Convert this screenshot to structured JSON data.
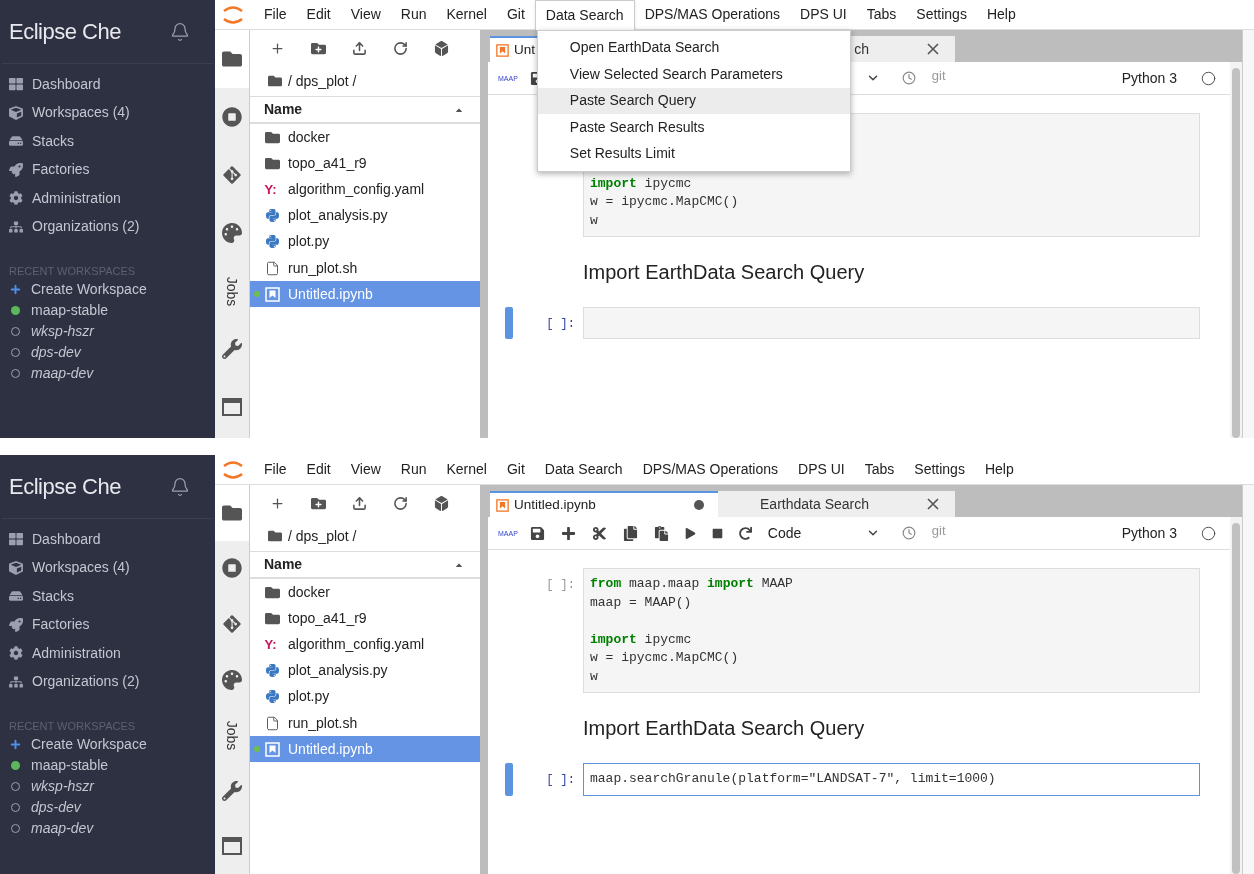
{
  "screens": [
    {
      "che": {
        "brand": "Eclipse Che",
        "nav": [
          {
            "label": "Dashboard"
          },
          {
            "label": "Workspaces (4)"
          },
          {
            "label": "Stacks"
          },
          {
            "label": "Factories"
          },
          {
            "label": "Administration"
          },
          {
            "label": "Organizations (2)"
          }
        ],
        "recent_heading": "RECENT WORKSPACES",
        "recent": [
          {
            "kind": "create",
            "label": "Create Workspace"
          },
          {
            "kind": "workspace",
            "label": "maap-stable",
            "running": true
          },
          {
            "kind": "workspace",
            "label": "wksp-hszr",
            "running": false
          },
          {
            "kind": "workspace",
            "label": "dps-dev",
            "running": false
          },
          {
            "kind": "workspace",
            "label": "maap-dev",
            "running": false
          }
        ]
      },
      "menu": [
        {
          "label": "File",
          "selected": false
        },
        {
          "label": "Edit",
          "selected": false
        },
        {
          "label": "View",
          "selected": false
        },
        {
          "label": "Run",
          "selected": false
        },
        {
          "label": "Kernel",
          "selected": false
        },
        {
          "label": "Git",
          "selected": false
        },
        {
          "label": "Data Search",
          "selected": true,
          "items": [
            {
              "label": "Open EarthData Search",
              "selected": false
            },
            {
              "label": "View Selected Search Parameters",
              "selected": false
            },
            {
              "label": "Paste Search Query",
              "selected": true
            },
            {
              "label": "Paste Search Results",
              "selected": false
            },
            {
              "label": "Set Results Limit",
              "selected": false
            }
          ]
        },
        {
          "label": "DPS/MAS Operations",
          "selected": false
        },
        {
          "label": "DPS UI",
          "selected": false
        },
        {
          "label": "Tabs",
          "selected": false
        },
        {
          "label": "Settings",
          "selected": false
        },
        {
          "label": "Help",
          "selected": false
        }
      ],
      "side_tabs": [
        {
          "kind": "folder",
          "selected": true
        },
        {
          "kind": "running",
          "selected": false
        },
        {
          "kind": "git",
          "selected": false
        },
        {
          "kind": "palette",
          "selected": false
        },
        {
          "kind": "text",
          "label": "Jobs",
          "selected": false
        },
        {
          "kind": "wrench",
          "selected": false
        },
        {
          "kind": "window",
          "selected": false
        }
      ],
      "files": {
        "path": "/ dps_plot /",
        "column": "Name",
        "items": [
          {
            "kind": "folder",
            "name": "docker",
            "selected": false,
            "running": false
          },
          {
            "kind": "folder",
            "name": "topo_a41_r9",
            "selected": false,
            "running": false
          },
          {
            "kind": "yaml",
            "badge": "Y:",
            "name": "algorithm_config.yaml",
            "selected": false,
            "running": false
          },
          {
            "kind": "python",
            "name": "plot_analysis.py",
            "selected": false,
            "running": false
          },
          {
            "kind": "python",
            "name": "plot.py",
            "selected": false,
            "running": false
          },
          {
            "kind": "file",
            "name": "run_plot.sh",
            "selected": false,
            "running": false
          },
          {
            "kind": "notebook",
            "name": "Untitled.ipynb",
            "selected": true,
            "running": true
          }
        ]
      },
      "tabs": [
        {
          "kind": "notebook",
          "label": "Unt",
          "selected": true
        },
        {
          "kind": "page",
          "label": "ch",
          "selected": false
        }
      ],
      "toolbar": {
        "logo": "MAAP",
        "git": "git",
        "kernel": "Python 3"
      },
      "cells": [
        {
          "kind": "code",
          "editing": false,
          "active": false,
          "blocks": [
            [
              "**import** ipycmc",
              "w = ipycmc.MapCMC()",
              "w"
            ]
          ]
        },
        {
          "kind": "heading",
          "text": "Import EarthData Search Query"
        },
        {
          "kind": "code",
          "prompt": "[ ]:",
          "editing": false,
          "active": true
        }
      ]
    },
    {
      "che": {
        "brand": "Eclipse Che",
        "nav": [
          {
            "label": "Dashboard"
          },
          {
            "label": "Workspaces (4)"
          },
          {
            "label": "Stacks"
          },
          {
            "label": "Factories"
          },
          {
            "label": "Administration"
          },
          {
            "label": "Organizations (2)"
          }
        ],
        "recent_heading": "RECENT WORKSPACES",
        "recent": [
          {
            "kind": "create",
            "label": "Create Workspace"
          },
          {
            "kind": "workspace",
            "label": "maap-stable",
            "running": true
          },
          {
            "kind": "workspace",
            "label": "wksp-hszr",
            "running": false
          },
          {
            "kind": "workspace",
            "label": "dps-dev",
            "running": false
          },
          {
            "kind": "workspace",
            "label": "maap-dev",
            "running": false
          }
        ]
      },
      "menu": [
        {
          "label": "File",
          "selected": false
        },
        {
          "label": "Edit",
          "selected": false
        },
        {
          "label": "View",
          "selected": false
        },
        {
          "label": "Run",
          "selected": false
        },
        {
          "label": "Kernel",
          "selected": false
        },
        {
          "label": "Git",
          "selected": false
        },
        {
          "label": "Data Search",
          "selected": false
        },
        {
          "label": "DPS/MAS Operations",
          "selected": false
        },
        {
          "label": "DPS UI",
          "selected": false
        },
        {
          "label": "Tabs",
          "selected": false
        },
        {
          "label": "Settings",
          "selected": false
        },
        {
          "label": "Help",
          "selected": false
        }
      ],
      "side_tabs": [
        {
          "kind": "folder",
          "selected": true
        },
        {
          "kind": "running",
          "selected": false
        },
        {
          "kind": "git",
          "selected": false
        },
        {
          "kind": "palette",
          "selected": false
        },
        {
          "kind": "text",
          "label": "Jobs",
          "selected": false
        },
        {
          "kind": "wrench",
          "selected": false
        },
        {
          "kind": "window",
          "selected": false
        }
      ],
      "files": {
        "path": "/ dps_plot /",
        "column": "Name",
        "items": [
          {
            "kind": "folder",
            "name": "docker",
            "selected": false,
            "running": false
          },
          {
            "kind": "folder",
            "name": "topo_a41_r9",
            "selected": false,
            "running": false
          },
          {
            "kind": "yaml",
            "badge": "Y:",
            "name": "algorithm_config.yaml",
            "selected": false,
            "running": false
          },
          {
            "kind": "python",
            "name": "plot_analysis.py",
            "selected": false,
            "running": false
          },
          {
            "kind": "python",
            "name": "plot.py",
            "selected": false,
            "running": false
          },
          {
            "kind": "file",
            "name": "run_plot.sh",
            "selected": false,
            "running": false
          },
          {
            "kind": "notebook",
            "name": "Untitled.ipynb",
            "selected": true,
            "running": true
          }
        ]
      },
      "tabs": [
        {
          "kind": "notebook",
          "label": "Untitled.ipynb",
          "selected": true,
          "modified": true
        },
        {
          "kind": "page",
          "label": "Earthdata Search",
          "selected": false
        }
      ],
      "toolbar": {
        "logo": "MAAP",
        "cell_type": "Code",
        "git": "git",
        "kernel": "Python 3"
      },
      "cells": [
        {
          "kind": "code",
          "prompt": "[ ]:",
          "editing": false,
          "active": false,
          "blocks": [
            [
              "**from** maap.maap **import** MAAP",
              "maap = MAAP()"
            ],
            [
              "**import** ipycmc",
              "w = ipycmc.MapCMC()",
              "w"
            ]
          ]
        },
        {
          "kind": "heading",
          "text": "Import EarthData Search Query"
        },
        {
          "kind": "code",
          "prompt": "[ ]:",
          "editing": true,
          "active": true,
          "blocks": [
            [
              "maap.searchGranule(platform=\"LANDSAT-7\", limit=1000)"
            ]
          ]
        }
      ]
    }
  ]
}
